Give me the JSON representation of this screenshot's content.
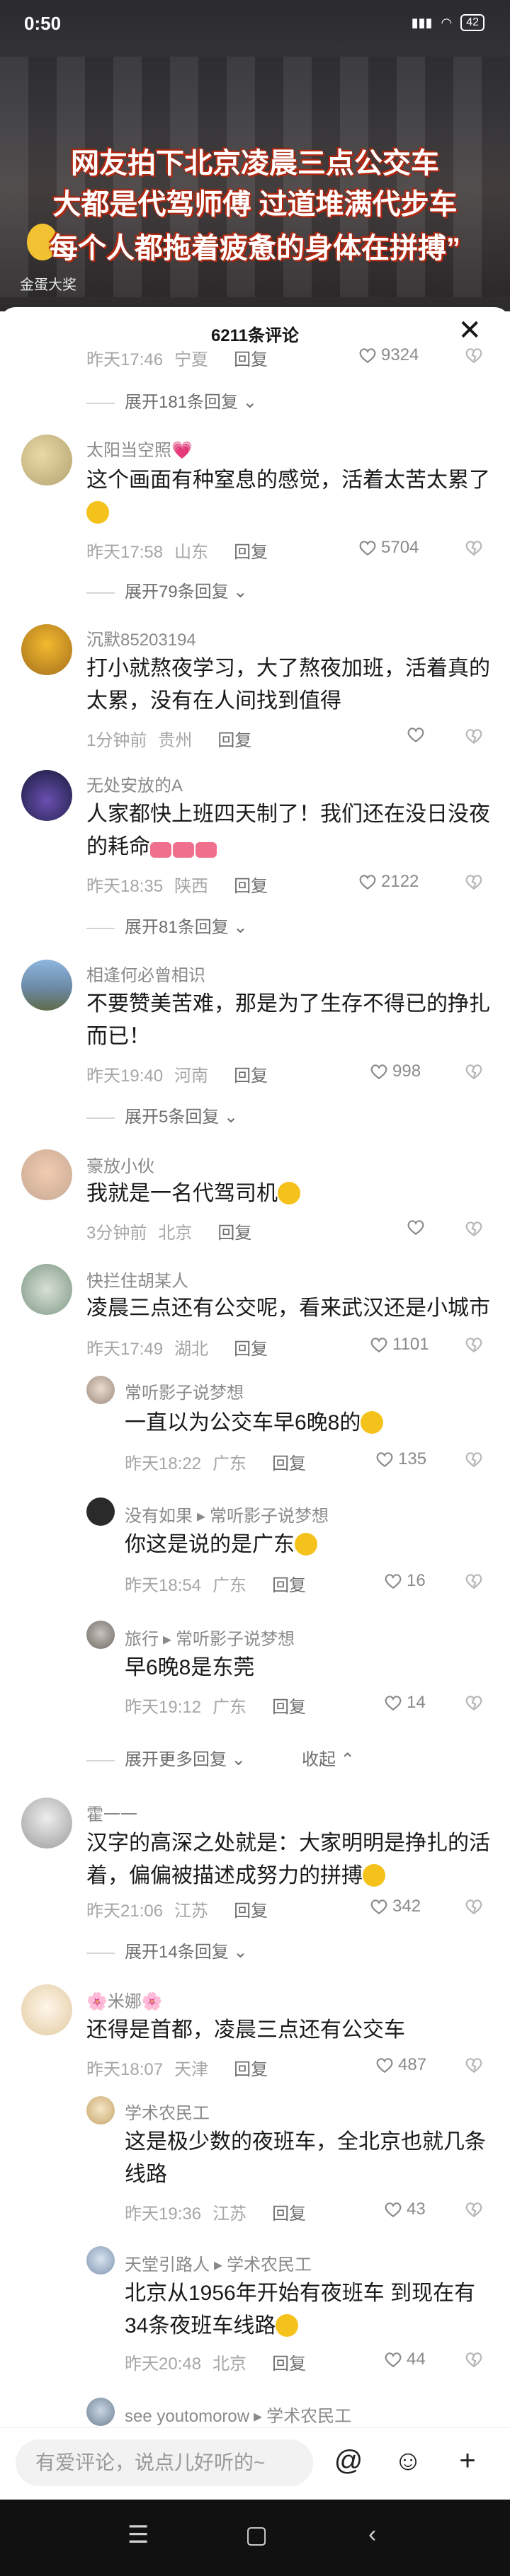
{
  "status": {
    "time": "0:50",
    "battery": "42"
  },
  "video": {
    "headline1": "网友拍下北京凌晨三点公交车",
    "headline2": "大都是代驾师傅 过道堆满代步车",
    "headline3": "每个人都拖着疲惫的身体在拼搏”",
    "watermark": "金蛋大奖"
  },
  "sheet": {
    "title": "6211条评论",
    "close_icon": "close-icon"
  },
  "comments": [
    {
      "time": "昨天17:46",
      "loc": "宁夏",
      "reply": "回复",
      "likes": "9324",
      "expand": "展开181条回复"
    },
    {
      "user": "太阳当空照💗",
      "text1": "这个画面有种窒息的感觉，活着太苦太累了",
      "time": "昨天17:58",
      "loc": "山东",
      "reply": "回复",
      "likes": "5704",
      "expand": "展开79条回复"
    },
    {
      "user": "沉默85203194",
      "text1": "打小就熬夜学习，大了熬夜加班，活着真的",
      "text2": "太累，没有在人间找到值得",
      "time": "1分钟前",
      "loc": "贵州",
      "reply": "回复"
    },
    {
      "user": "无处安放的A",
      "text1": "人家都快上班四天制了！我们还在没日没夜",
      "text2": "的耗命",
      "time": "昨天18:35",
      "loc": "陕西",
      "reply": "回复",
      "likes": "2122",
      "expand": "展开81条回复"
    },
    {
      "user": "相逢何必曾相识",
      "text1": "不要赞美苦难，那是为了生存不得已的挣扎",
      "text2": "而已！",
      "time": "昨天19:40",
      "loc": "河南",
      "reply": "回复",
      "likes": "998",
      "expand": "展开5条回复"
    },
    {
      "user": "豪放小伙",
      "text1": "我就是一名代驾司机",
      "time": "3分钟前",
      "loc": "北京",
      "reply": "回复"
    },
    {
      "user": "快拦住胡某人",
      "text1": "凌晨三点还有公交呢，看来武汉还是小城市",
      "time": "昨天17:49",
      "loc": "湖北",
      "reply": "回复",
      "likes": "1101"
    },
    {
      "user": "常听影子说梦想",
      "text1": "一直以为公交车早6晚8的",
      "time": "昨天18:22",
      "loc": "广东",
      "reply": "回复",
      "likes": "135"
    },
    {
      "user": "没有如果",
      "reply_to": "常听影子说梦想",
      "text1": "你这是说的是广东",
      "time": "昨天18:54",
      "loc": "广东",
      "reply": "回复",
      "likes": "16"
    },
    {
      "user": "旅行",
      "reply_to": "常听影子说梦想",
      "text1": "早6晚8是东莞",
      "time": "昨天19:12",
      "loc": "广东",
      "reply": "回复",
      "likes": "14",
      "expand": "展开更多回复",
      "collapse": "收起"
    },
    {
      "user": "霍一一",
      "text1": "汉字的高深之处就是：大家明明是挣扎的活",
      "text2": "着，偏偏被描述成努力的拼搏",
      "time": "昨天21:06",
      "loc": "江苏",
      "reply": "回复",
      "likes": "342",
      "expand": "展开14条回复"
    },
    {
      "user": "🌸米娜🌸",
      "text1": "还得是首都，凌晨三点还有公交车",
      "time": "昨天18:07",
      "loc": "天津",
      "reply": "回复",
      "likes": "487"
    },
    {
      "user": "学术农民工",
      "text1": "这是极少数的夜班车，全北京也就几条",
      "text2": "线路",
      "time": "昨天19:36",
      "loc": "江苏",
      "reply": "回复",
      "likes": "43"
    },
    {
      "user": "天堂引路人",
      "reply_to": "学术农民工",
      "text1": "北京从1956年开始有夜班车 到现在有",
      "text2": "34条夜班车线路",
      "time": "昨天20:48",
      "loc": "北京",
      "reply": "回复",
      "likes": "44"
    },
    {
      "user": "see youtomorow",
      "reply_to": "学术农民工"
    }
  ],
  "input": {
    "placeholder": "有爱评论，说点儿好听的~",
    "at_icon": "@",
    "emoji_icon": "☺",
    "add_icon": "+"
  },
  "navbar": {
    "menu": "☰",
    "home": "▢",
    "back": "‹"
  }
}
